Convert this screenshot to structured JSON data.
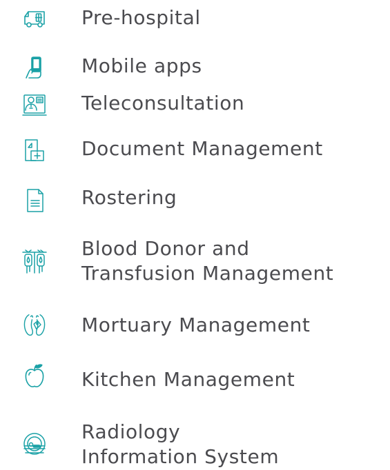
{
  "accent_color": "#1aa1a6",
  "text_color": "#4b4b4f",
  "items": [
    {
      "icon": "ambulance-icon",
      "lines": [
        "Pre-hospital"
      ]
    },
    {
      "icon": "mobile-phone-hand-icon",
      "lines": [
        "Mobile apps"
      ]
    },
    {
      "icon": "doctor-screen-icon",
      "lines": [
        "Teleconsultation"
      ]
    },
    {
      "icon": "medical-document-icon",
      "lines": [
        "Document Management"
      ]
    },
    {
      "icon": "document-lines-icon",
      "lines": [
        "Rostering"
      ]
    },
    {
      "icon": "blood-bags-icon",
      "lines": [
        "Blood Donor and",
        "Transfusion Management"
      ]
    },
    {
      "icon": "feet-tag-icon",
      "lines": [
        "Mortuary Management"
      ]
    },
    {
      "icon": "apple-icon",
      "lines": [
        "Kitchen Management"
      ]
    },
    {
      "icon": "mri-scanner-icon",
      "lines": [
        "Radiology",
        "Information System"
      ]
    }
  ]
}
